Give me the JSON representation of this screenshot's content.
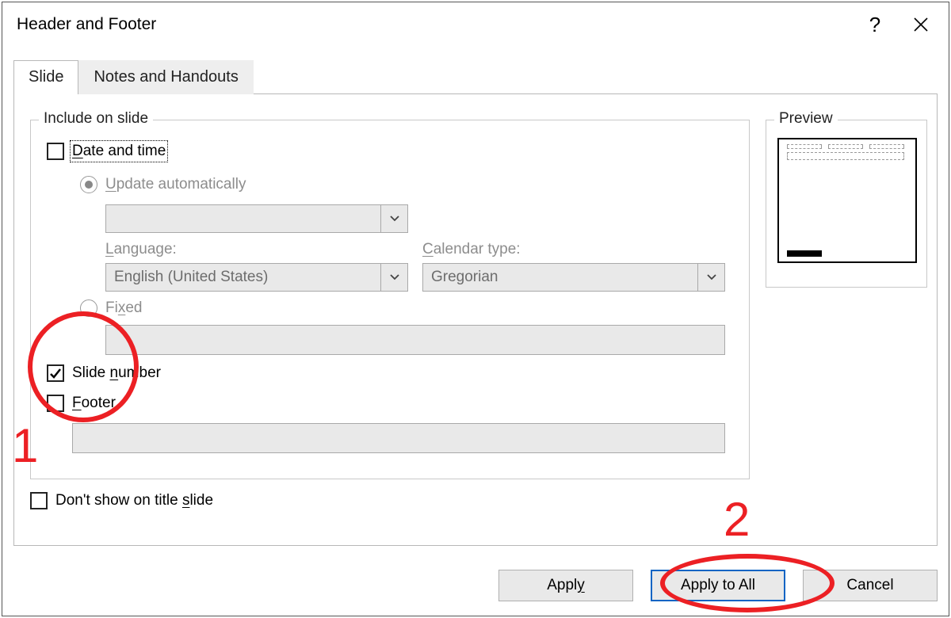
{
  "dialog": {
    "title": "Header and Footer"
  },
  "tabs": {
    "slide": "Slide",
    "notes": "Notes and Handouts"
  },
  "include": {
    "legend": "Include on slide",
    "date_time": "Date and time",
    "update_auto": "Update automatically",
    "date_format_value": "",
    "language_label": "Language:",
    "language_value": "English (United States)",
    "calendar_label": "Calendar type:",
    "calendar_value": "Gregorian",
    "fixed": "Fixed",
    "fixed_value": "",
    "slide_number": "Slide number",
    "footer": "Footer",
    "footer_value": ""
  },
  "preview": {
    "legend": "Preview"
  },
  "dont_show": "Don't show on title slide",
  "buttons": {
    "apply": "Apply",
    "apply_all": "Apply to All",
    "cancel": "Cancel"
  },
  "annotations": {
    "one": "1",
    "two": "2"
  }
}
